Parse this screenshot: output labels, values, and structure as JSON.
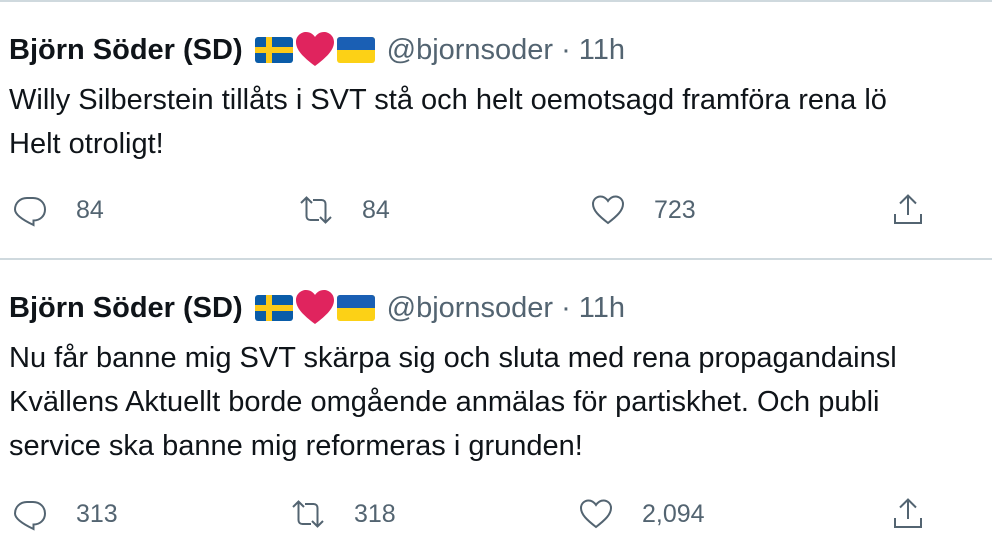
{
  "tweets": [
    {
      "author_name": "Björn Söder (SD)",
      "handle": "@bjornsoder",
      "separator": "·",
      "time": "11h",
      "text": "Willy Silberstein tillåts i SVT stå och helt oemotsagd framföra rena lö\nHelt otroligt!",
      "replies": "84",
      "retweets": "84",
      "likes": "723",
      "name_emojis": [
        "swedish-flag",
        "red-heart",
        "ukrainian-flag"
      ]
    },
    {
      "author_name": "Björn Söder (SD)",
      "handle": "@bjornsoder",
      "separator": "·",
      "time": "11h",
      "text": "Nu får banne mig SVT skärpa sig och sluta med rena propagandainsl\nKvällens Aktuellt borde omgående anmälas för partiskhet. Och publi\nservice ska banne mig reformeras i grunden!",
      "replies": "313",
      "retweets": "318",
      "likes": "2,094",
      "name_emojis": [
        "swedish-flag",
        "red-heart",
        "ukrainian-flag"
      ]
    }
  ],
  "colors": {
    "text": "#0f1419",
    "secondary": "#536471",
    "divider": "#cfd9de",
    "heart": "#e0245e"
  },
  "icons": {
    "reply": "reply-icon",
    "retweet": "retweet-icon",
    "like": "like-icon",
    "share": "share-icon"
  }
}
